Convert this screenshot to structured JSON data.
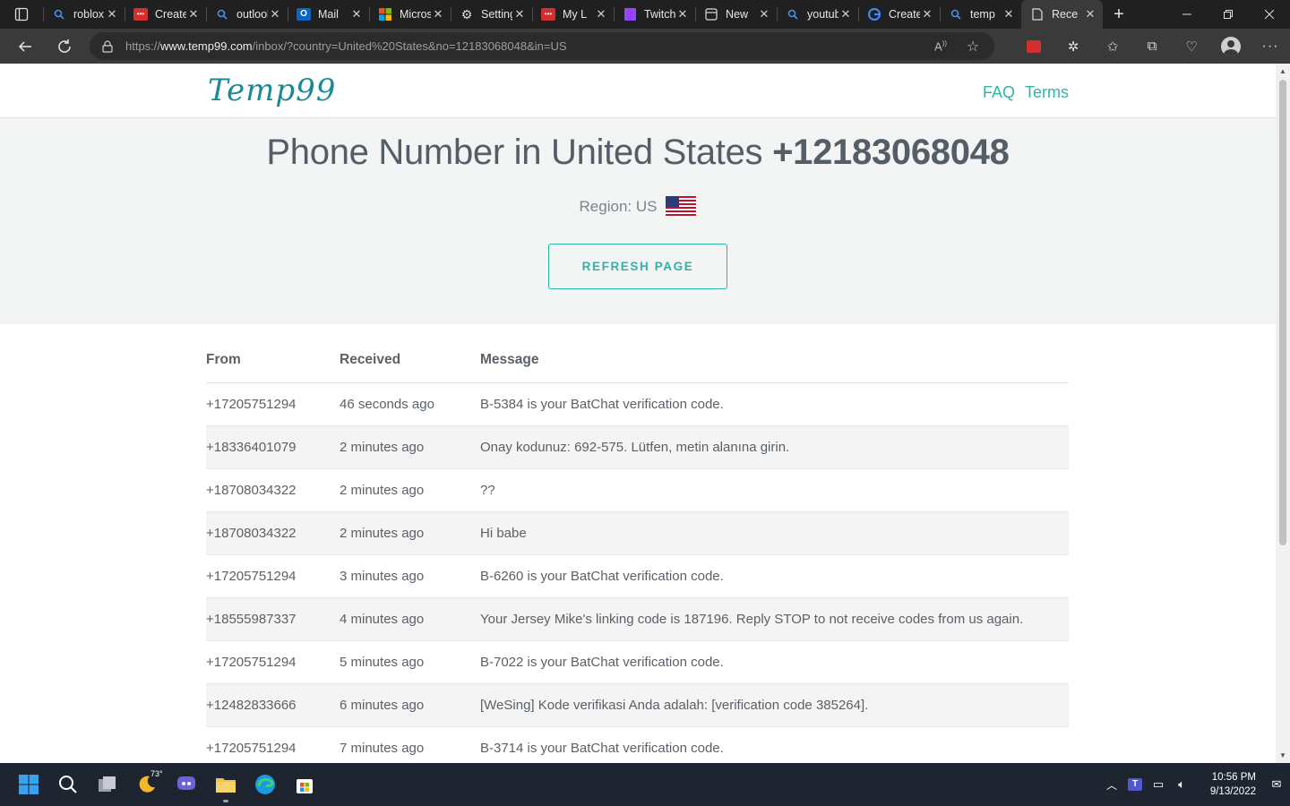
{
  "browser": {
    "tabs": [
      {
        "title": "roblox",
        "icon": "search-icon"
      },
      {
        "title": "Create",
        "icon": "red-app-icon"
      },
      {
        "title": "outlook",
        "icon": "search-icon"
      },
      {
        "title": "Mail",
        "icon": "outlook-icon"
      },
      {
        "title": "Microsoft",
        "icon": "microsoft-icon"
      },
      {
        "title": "Settings",
        "icon": "gear-icon"
      },
      {
        "title": "My L",
        "icon": "red-app-icon"
      },
      {
        "title": "Twitch",
        "icon": "twitch-icon"
      },
      {
        "title": "New",
        "icon": "newtab-icon"
      },
      {
        "title": "youtube",
        "icon": "search-icon"
      },
      {
        "title": "Create",
        "icon": "google-icon"
      },
      {
        "title": "temp",
        "icon": "search-icon"
      },
      {
        "title": "Rece",
        "icon": "document-icon",
        "active": true
      }
    ],
    "url_prefix": "https://",
    "url_domain": "www.temp99.com",
    "url_path": "/inbox/?country=United%20States&no=12183068048&in=US"
  },
  "site": {
    "logo": "Temp99",
    "nav": {
      "faq": "FAQ",
      "terms": "Terms"
    }
  },
  "hero": {
    "title_prefix": "Phone Number in United States",
    "number": "+12183068048",
    "region_label": "Region: US",
    "refresh_label": "REFRESH PAGE"
  },
  "table": {
    "headers": {
      "from": "From",
      "received": "Received",
      "message": "Message"
    },
    "rows": [
      {
        "from": "+17205751294",
        "received": "46 seconds ago",
        "message": "B-5384 is your BatChat verification code."
      },
      {
        "from": "+18336401079",
        "received": "2 minutes ago",
        "message": "Onay kodunuz: 692-575. Lütfen, metin alanına girin."
      },
      {
        "from": "+18708034322",
        "received": "2 minutes ago",
        "message": "??"
      },
      {
        "from": "+18708034322",
        "received": "2 minutes ago",
        "message": "Hi babe"
      },
      {
        "from": "+17205751294",
        "received": "3 minutes ago",
        "message": "B-6260 is your BatChat verification code."
      },
      {
        "from": "+18555987337",
        "received": "4 minutes ago",
        "message": "Your Jersey Mike's linking code is 187196. Reply STOP to not receive codes from us again."
      },
      {
        "from": "+17205751294",
        "received": "5 minutes ago",
        "message": "B-7022 is your BatChat verification code."
      },
      {
        "from": "+12482833666",
        "received": "6 minutes ago",
        "message": "[WeSing] Kode verifikasi Anda adalah: [verification code 385264]."
      },
      {
        "from": "+17205751294",
        "received": "7 minutes ago",
        "message": "B-3714 is your BatChat verification code."
      }
    ]
  },
  "taskbar": {
    "weather_temp": "73°",
    "time": "10:56 PM",
    "date": "9/13/2022"
  },
  "colors": {
    "accent": "#2db5a6",
    "logo": "#1a8a94",
    "hero_bg": "#f3f5f5"
  }
}
